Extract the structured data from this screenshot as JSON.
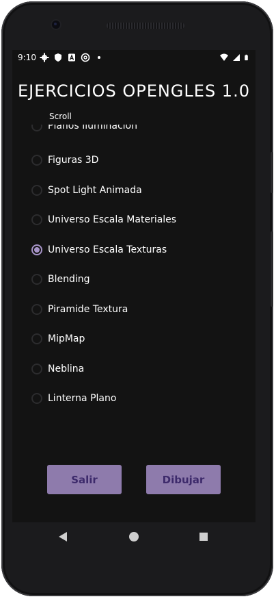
{
  "status_bar": {
    "time": "9:10",
    "left_icons": [
      "gear-icon",
      "shield-icon",
      "a-icon",
      "at-icon",
      "dot-icon"
    ],
    "right_icons": [
      "wifi-icon",
      "signal-icon",
      "battery-icon"
    ]
  },
  "app": {
    "title": "EJERCICIOS OPENGLES 1.0",
    "scroll_label": "Scroll",
    "accent_color": "#a794c8",
    "button_color": "#8e7bac",
    "options": [
      {
        "label": "Planos Iluminacion",
        "checked": false
      },
      {
        "label": "Figuras 3D",
        "checked": false
      },
      {
        "label": "Spot Light Animada",
        "checked": false
      },
      {
        "label": "Universo Escala Materiales",
        "checked": false
      },
      {
        "label": "Universo Escala Texturas",
        "checked": true
      },
      {
        "label": "Blending",
        "checked": false
      },
      {
        "label": "Piramide Textura",
        "checked": false
      },
      {
        "label": "MipMap",
        "checked": false
      },
      {
        "label": "Neblina",
        "checked": false
      },
      {
        "label": "Linterna Plano",
        "checked": false
      }
    ],
    "buttons": {
      "exit_label": "Salir",
      "draw_label": "Dibujar"
    }
  },
  "nav_bar": {
    "icons": [
      "back-icon",
      "home-icon",
      "recents-icon"
    ]
  }
}
